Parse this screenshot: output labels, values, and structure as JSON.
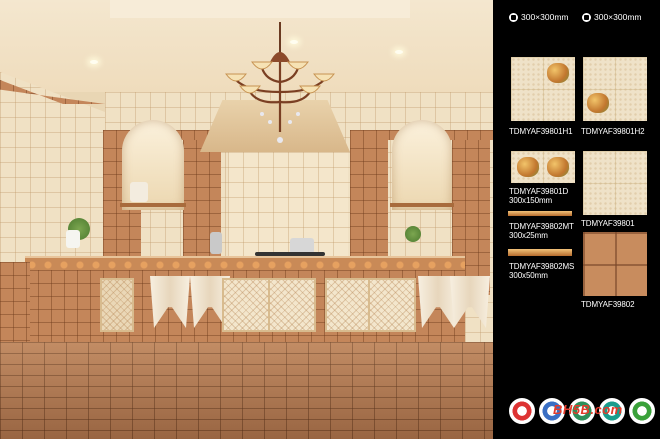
{
  "panel": {
    "spec_wall": "300×300mm",
    "spec_floor": "300×300mm",
    "products": [
      {
        "code": "TDMYAF39801H1",
        "size": ""
      },
      {
        "code": "TDMYAF39801H2",
        "size": ""
      },
      {
        "code": "TDMYAF39801D",
        "size": "300x150mm"
      },
      {
        "code": "TDMYAF39801",
        "size": ""
      },
      {
        "code": "TDMYAF39802MT",
        "size": "300x25mm"
      },
      {
        "code": "TDMYAF39802MS",
        "size": "300x50mm"
      },
      {
        "code": "TDMYAF39802",
        "size": ""
      }
    ],
    "watermark": "BH5B.com"
  },
  "icons": [
    "wall-tile-icon",
    "floor-tile-icon",
    "certification-logos"
  ]
}
